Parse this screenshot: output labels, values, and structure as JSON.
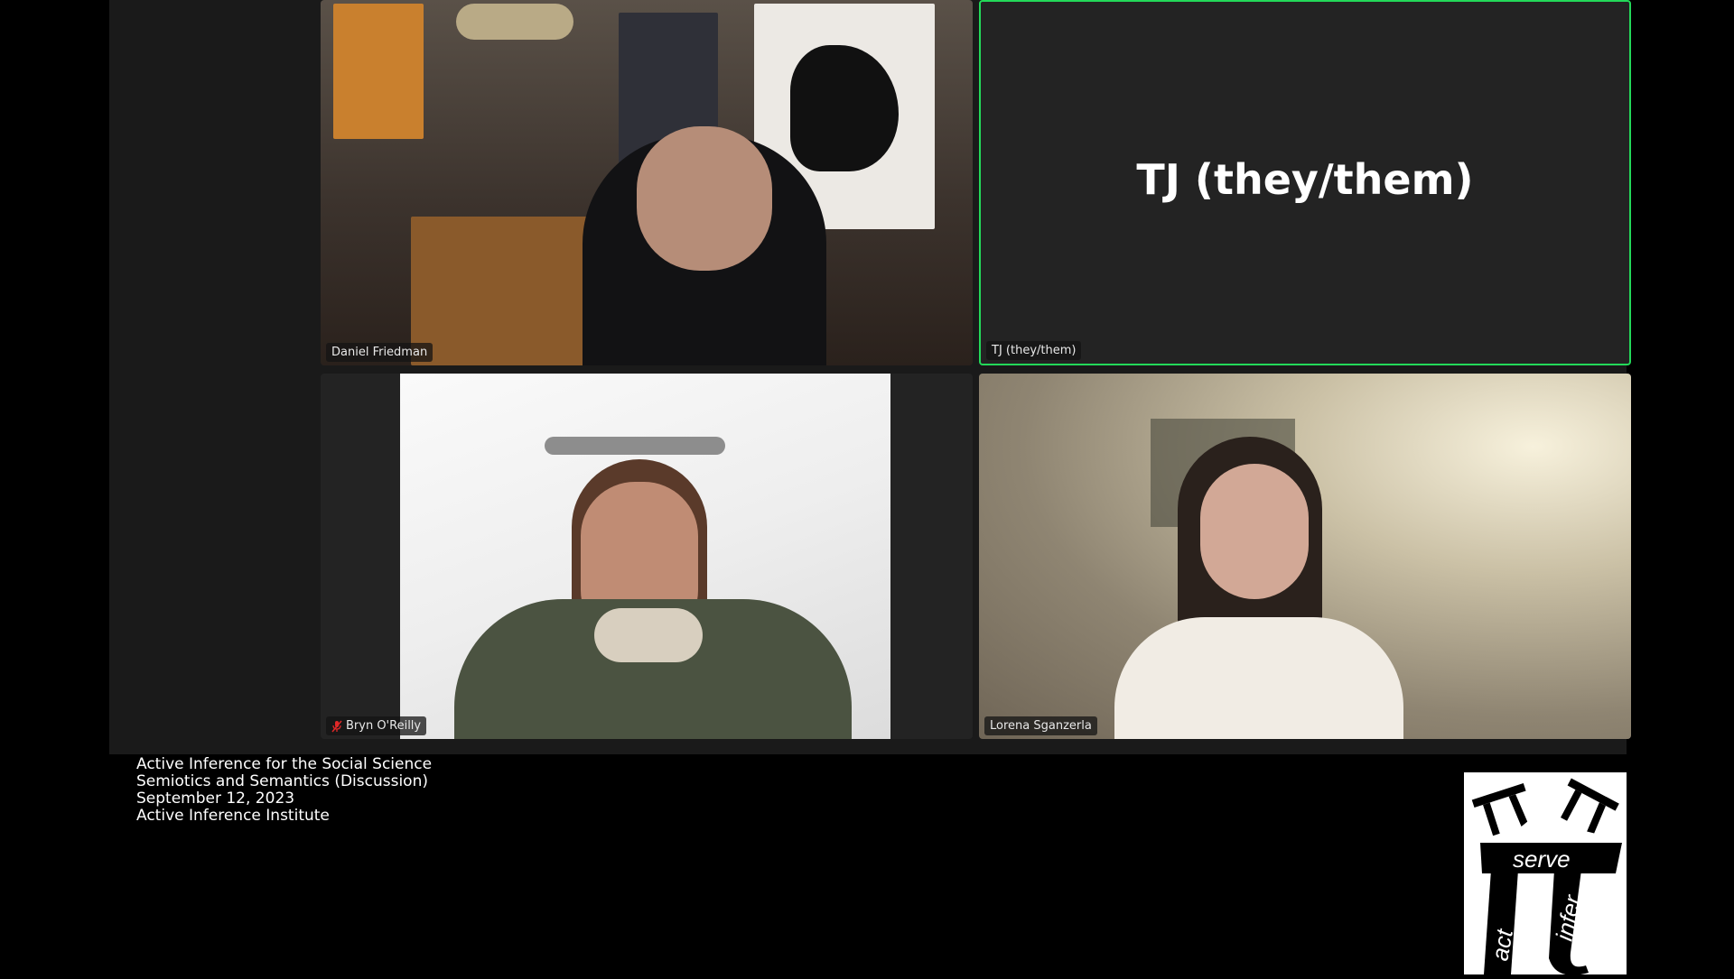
{
  "participants": [
    {
      "name": "Daniel Friedman",
      "muted": false,
      "speaking": false,
      "video": true
    },
    {
      "name": "TJ (they/them)",
      "muted": false,
      "speaking": true,
      "video": false,
      "placeholder": "TJ (they/them)"
    },
    {
      "name": "Bryn O'Reilly",
      "muted": true,
      "speaking": false,
      "video": true
    },
    {
      "name": "Lorena Sganzerla",
      "muted": false,
      "speaking": false,
      "video": true
    }
  ],
  "caption": {
    "line1": "Active Inference for the Social Science",
    "line2": "Semiotics and Semantics (Discussion)",
    "line3": "September 12, 2023",
    "line4": "Active Inference Institute"
  },
  "logo": {
    "word_serve": "serve",
    "word_act": "act",
    "word_infer": "infer"
  },
  "colors": {
    "speaking_border": "#23d959",
    "tile_bg": "#232323",
    "stage_bg": "#1a1a1a",
    "mute_red": "#e02828"
  }
}
